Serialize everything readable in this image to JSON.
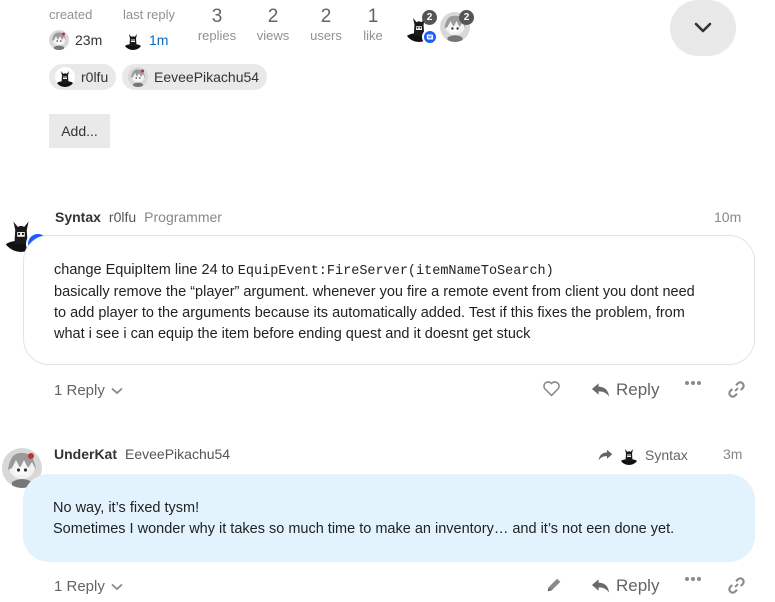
{
  "topic_map": {
    "created_label": "created",
    "created_value": "23m",
    "last_reply_label": "last reply",
    "last_reply_value": "1m",
    "replies_count": "3",
    "replies_label": "replies",
    "views_count": "2",
    "views_label": "views",
    "users_count": "2",
    "users_label": "users",
    "like_count": "1",
    "like_label": "like",
    "participant_1_count": "2",
    "participant_2_count": "2"
  },
  "participants": [
    {
      "name": "r0lfu"
    },
    {
      "name": "EeveePikachu54"
    }
  ],
  "add_button": "Add...",
  "posts": [
    {
      "display_name": "Syntax",
      "username": "r0lfu",
      "title": "Programmer",
      "time": "10m",
      "body_line1_prefix": "change EquipItem line 24 to ",
      "body_code": "EquipEvent:FireServer(itemNameToSearch)",
      "body_rest_1": "basically remove the “player” argument. whenever you fire a remote event from client you dont need",
      "body_rest_2": "to add player to the arguments because its automatically added. Test if this fixes the problem, from",
      "body_rest_3": "what i see i can equip the item before ending quest and it doesnt get stuck",
      "replies_toggle": "1 Reply",
      "reply_label": "Reply"
    },
    {
      "display_name": "UnderKat",
      "username": "EeveePikachu54",
      "reply_to": "Syntax",
      "time": "3m",
      "body_line1": "No way, it’s fixed tysm!",
      "body_line2": "Sometimes I wonder why it takes so much time to make an inventory… and it’s not een done yet.",
      "replies_toggle": "1 Reply",
      "reply_label": "Reply"
    }
  ],
  "colors": {
    "accent_blue": "#1a5cff",
    "link_blue": "#0a67c8",
    "highlight_bubble": "#e2f3fe",
    "chip_grey": "#e9e9e9"
  }
}
